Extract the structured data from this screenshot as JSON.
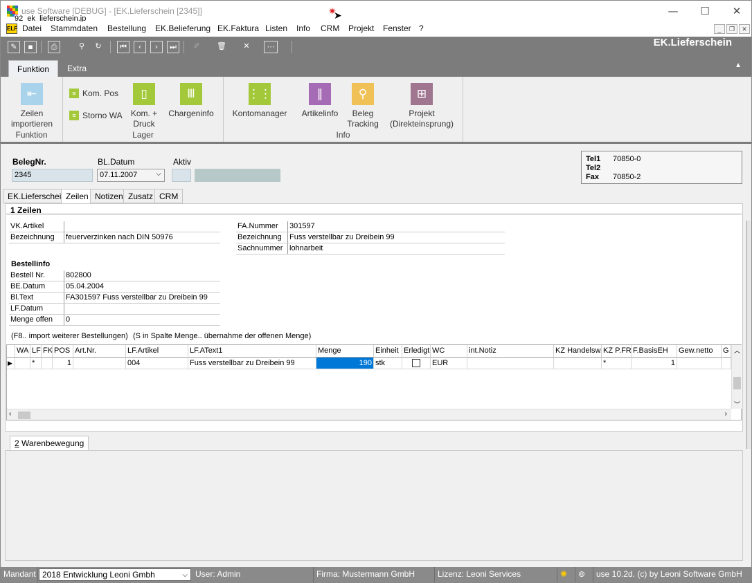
{
  "window": {
    "title": "use Software [DEBUG] - [EK.Lieferschein [2345]]",
    "tooltip": "92_ek_lieferschein.jp"
  },
  "menu": [
    "Datei",
    "Stammdaten",
    "Bestellung",
    "EK.Belieferung",
    "EK.Faktura",
    "Listen",
    "Info",
    "CRM",
    "Projekt",
    "Fenster",
    "?"
  ],
  "app_title": "EK.Lieferschein",
  "ribbon": {
    "tabs": [
      "Funktion",
      "Extra"
    ],
    "groups": {
      "funktion": "Funktion",
      "lager": "Lager",
      "info": "Info"
    },
    "buttons": {
      "zeilen_importieren": "Zeilen importieren",
      "kom_pos": "Kom. Pos",
      "storno_wa": "Storno WA",
      "kom_druck": "Kom. + Druck",
      "chargeninfo": "Chargeninfo",
      "kontomanager": "Kontomanager",
      "artikelinfo": "Artikelinfo",
      "beleg_tracking": "Beleg Tracking",
      "projekt": "Projekt (Direkteinsprung)"
    }
  },
  "header": {
    "belegnr_label": "BelegNr.",
    "belegnr": "2345",
    "bldatum_label": "BL.Datum",
    "bldatum": "07.11.2007",
    "aktiv_label": "Aktiv",
    "tel1_label": "Tel1",
    "tel1": "70850-0",
    "tel2_label": "Tel2",
    "tel2": "",
    "fax_label": "Fax",
    "fax": "70850-2"
  },
  "subtabs": [
    "EK.Lieferschein",
    "Zeilen",
    "Notizen",
    "Zusatz",
    "CRM"
  ],
  "section": {
    "num": "1",
    "title": "Zeilen",
    "bestellinfo": "Bestellinfo",
    "hint1": "(F8.. import weiterer Bestellungen)",
    "hint2": "(S in Spalte Menge.. übernahme der offenen Menge)"
  },
  "fields_left": [
    {
      "k": "VK.Artikel",
      "v": ""
    },
    {
      "k": "Bezeichnung",
      "v": "feuerverzinken nach DIN 50976"
    }
  ],
  "fields_right": [
    {
      "k": "FA.Nummer",
      "v": "301597"
    },
    {
      "k": "Bezeichnung",
      "v": "Fuss verstellbar zu Dreibein 99"
    },
    {
      "k": "Sachnummer",
      "v": "lohnarbeit"
    }
  ],
  "fields_bestell": [
    {
      "k": "Bestell Nr.",
      "v": "802800"
    },
    {
      "k": "BE.Datum",
      "v": "05.04.2004"
    },
    {
      "k": "Bl.Text",
      "v": "FA301597 Fuss verstellbar zu Dreibein 99"
    },
    {
      "k": "LF.Datum",
      "v": ""
    },
    {
      "k": "Menge offen",
      "v": "0"
    }
  ],
  "grid": {
    "columns": [
      "WA",
      "LF",
      "FK",
      "POS",
      "Art.Nr.",
      "LF.Artikel",
      "LF.AText1",
      "Menge",
      "Einheit",
      "Erledigt",
      "WC",
      "int.Notiz",
      "KZ Handelsw.",
      "KZ P.FR",
      "F.BasisEH",
      "Gew.netto",
      "G"
    ],
    "row": [
      "",
      "*",
      "",
      "1",
      "",
      "004",
      "Fuss verstellbar zu Dreibein 99",
      "190",
      "stk",
      "",
      "EUR",
      "",
      "",
      "*",
      "1",
      "",
      ""
    ]
  },
  "lower": {
    "num": "2",
    "tab": "Warenbewegung"
  },
  "status": {
    "mandant_label": "Mandant",
    "mandant": "2018  Entwicklung Leoni Gmbh",
    "user": "User: Admin",
    "firma": "Firma: Mustermann GmbH",
    "lizenz": "Lizenz: Leoni Services",
    "version": "use 10.2d. (c) by Leoni Software GmbH"
  },
  "colors": {
    "toolbar": "#7c7c7c",
    "input_bg": "#d9e3ea",
    "selection": "#0078d7",
    "ribbon_blue": "#a9d3ea",
    "ribbon_green": "#a3c93a",
    "ribbon_purple": "#a66bb5",
    "ribbon_orange": "#f0c156",
    "ribbon_mauve": "#9f7590"
  }
}
